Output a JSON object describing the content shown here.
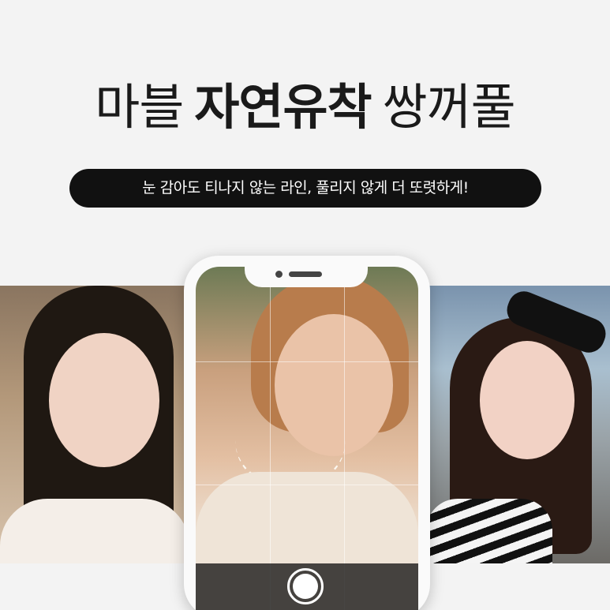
{
  "headline": {
    "prefix": "마블",
    "emphasis": "자연유착",
    "suffix": "쌍꺼풀"
  },
  "tagline": "눈 감아도 티나지 않는 라인, 풀리지 않게 더 또렷하게!",
  "colors": {
    "background": "#f3f3f3",
    "headline_text": "#1a1a1a",
    "pill_background": "#111111",
    "pill_text": "#ffffff"
  },
  "images": {
    "left": "portrait-photo-long-black-hair",
    "center": "selfie-photo-in-phone-frame",
    "right": "portrait-photo-seaside-sunglasses"
  },
  "phone": {
    "icons": [
      "speaker-grille",
      "front-camera",
      "shutter-button"
    ]
  }
}
